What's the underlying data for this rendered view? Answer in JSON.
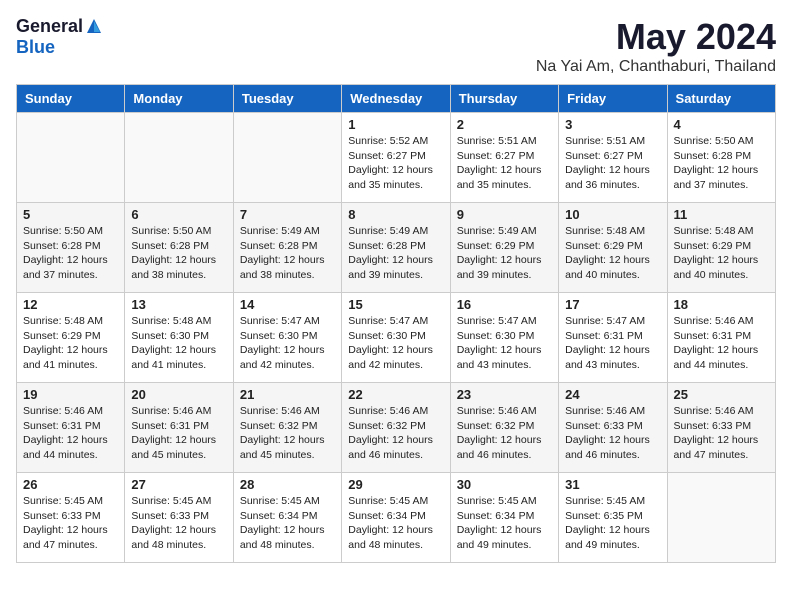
{
  "header": {
    "logo_general": "General",
    "logo_blue": "Blue",
    "month_title": "May 2024",
    "location": "Na Yai Am, Chanthaburi, Thailand"
  },
  "weekdays": [
    "Sunday",
    "Monday",
    "Tuesday",
    "Wednesday",
    "Thursday",
    "Friday",
    "Saturday"
  ],
  "weeks": [
    [
      {
        "day": "",
        "sunrise": "",
        "sunset": "",
        "daylight": "",
        "empty": true
      },
      {
        "day": "",
        "sunrise": "",
        "sunset": "",
        "daylight": "",
        "empty": true
      },
      {
        "day": "",
        "sunrise": "",
        "sunset": "",
        "daylight": "",
        "empty": true
      },
      {
        "day": "1",
        "sunrise": "Sunrise: 5:52 AM",
        "sunset": "Sunset: 6:27 PM",
        "daylight": "Daylight: 12 hours and 35 minutes.",
        "empty": false
      },
      {
        "day": "2",
        "sunrise": "Sunrise: 5:51 AM",
        "sunset": "Sunset: 6:27 PM",
        "daylight": "Daylight: 12 hours and 35 minutes.",
        "empty": false
      },
      {
        "day": "3",
        "sunrise": "Sunrise: 5:51 AM",
        "sunset": "Sunset: 6:27 PM",
        "daylight": "Daylight: 12 hours and 36 minutes.",
        "empty": false
      },
      {
        "day": "4",
        "sunrise": "Sunrise: 5:50 AM",
        "sunset": "Sunset: 6:28 PM",
        "daylight": "Daylight: 12 hours and 37 minutes.",
        "empty": false
      }
    ],
    [
      {
        "day": "5",
        "sunrise": "Sunrise: 5:50 AM",
        "sunset": "Sunset: 6:28 PM",
        "daylight": "Daylight: 12 hours and 37 minutes.",
        "empty": false
      },
      {
        "day": "6",
        "sunrise": "Sunrise: 5:50 AM",
        "sunset": "Sunset: 6:28 PM",
        "daylight": "Daylight: 12 hours and 38 minutes.",
        "empty": false
      },
      {
        "day": "7",
        "sunrise": "Sunrise: 5:49 AM",
        "sunset": "Sunset: 6:28 PM",
        "daylight": "Daylight: 12 hours and 38 minutes.",
        "empty": false
      },
      {
        "day": "8",
        "sunrise": "Sunrise: 5:49 AM",
        "sunset": "Sunset: 6:28 PM",
        "daylight": "Daylight: 12 hours and 39 minutes.",
        "empty": false
      },
      {
        "day": "9",
        "sunrise": "Sunrise: 5:49 AM",
        "sunset": "Sunset: 6:29 PM",
        "daylight": "Daylight: 12 hours and 39 minutes.",
        "empty": false
      },
      {
        "day": "10",
        "sunrise": "Sunrise: 5:48 AM",
        "sunset": "Sunset: 6:29 PM",
        "daylight": "Daylight: 12 hours and 40 minutes.",
        "empty": false
      },
      {
        "day": "11",
        "sunrise": "Sunrise: 5:48 AM",
        "sunset": "Sunset: 6:29 PM",
        "daylight": "Daylight: 12 hours and 40 minutes.",
        "empty": false
      }
    ],
    [
      {
        "day": "12",
        "sunrise": "Sunrise: 5:48 AM",
        "sunset": "Sunset: 6:29 PM",
        "daylight": "Daylight: 12 hours and 41 minutes.",
        "empty": false
      },
      {
        "day": "13",
        "sunrise": "Sunrise: 5:48 AM",
        "sunset": "Sunset: 6:30 PM",
        "daylight": "Daylight: 12 hours and 41 minutes.",
        "empty": false
      },
      {
        "day": "14",
        "sunrise": "Sunrise: 5:47 AM",
        "sunset": "Sunset: 6:30 PM",
        "daylight": "Daylight: 12 hours and 42 minutes.",
        "empty": false
      },
      {
        "day": "15",
        "sunrise": "Sunrise: 5:47 AM",
        "sunset": "Sunset: 6:30 PM",
        "daylight": "Daylight: 12 hours and 42 minutes.",
        "empty": false
      },
      {
        "day": "16",
        "sunrise": "Sunrise: 5:47 AM",
        "sunset": "Sunset: 6:30 PM",
        "daylight": "Daylight: 12 hours and 43 minutes.",
        "empty": false
      },
      {
        "day": "17",
        "sunrise": "Sunrise: 5:47 AM",
        "sunset": "Sunset: 6:31 PM",
        "daylight": "Daylight: 12 hours and 43 minutes.",
        "empty": false
      },
      {
        "day": "18",
        "sunrise": "Sunrise: 5:46 AM",
        "sunset": "Sunset: 6:31 PM",
        "daylight": "Daylight: 12 hours and 44 minutes.",
        "empty": false
      }
    ],
    [
      {
        "day": "19",
        "sunrise": "Sunrise: 5:46 AM",
        "sunset": "Sunset: 6:31 PM",
        "daylight": "Daylight: 12 hours and 44 minutes.",
        "empty": false
      },
      {
        "day": "20",
        "sunrise": "Sunrise: 5:46 AM",
        "sunset": "Sunset: 6:31 PM",
        "daylight": "Daylight: 12 hours and 45 minutes.",
        "empty": false
      },
      {
        "day": "21",
        "sunrise": "Sunrise: 5:46 AM",
        "sunset": "Sunset: 6:32 PM",
        "daylight": "Daylight: 12 hours and 45 minutes.",
        "empty": false
      },
      {
        "day": "22",
        "sunrise": "Sunrise: 5:46 AM",
        "sunset": "Sunset: 6:32 PM",
        "daylight": "Daylight: 12 hours and 46 minutes.",
        "empty": false
      },
      {
        "day": "23",
        "sunrise": "Sunrise: 5:46 AM",
        "sunset": "Sunset: 6:32 PM",
        "daylight": "Daylight: 12 hours and 46 minutes.",
        "empty": false
      },
      {
        "day": "24",
        "sunrise": "Sunrise: 5:46 AM",
        "sunset": "Sunset: 6:33 PM",
        "daylight": "Daylight: 12 hours and 46 minutes.",
        "empty": false
      },
      {
        "day": "25",
        "sunrise": "Sunrise: 5:46 AM",
        "sunset": "Sunset: 6:33 PM",
        "daylight": "Daylight: 12 hours and 47 minutes.",
        "empty": false
      }
    ],
    [
      {
        "day": "26",
        "sunrise": "Sunrise: 5:45 AM",
        "sunset": "Sunset: 6:33 PM",
        "daylight": "Daylight: 12 hours and 47 minutes.",
        "empty": false
      },
      {
        "day": "27",
        "sunrise": "Sunrise: 5:45 AM",
        "sunset": "Sunset: 6:33 PM",
        "daylight": "Daylight: 12 hours and 48 minutes.",
        "empty": false
      },
      {
        "day": "28",
        "sunrise": "Sunrise: 5:45 AM",
        "sunset": "Sunset: 6:34 PM",
        "daylight": "Daylight: 12 hours and 48 minutes.",
        "empty": false
      },
      {
        "day": "29",
        "sunrise": "Sunrise: 5:45 AM",
        "sunset": "Sunset: 6:34 PM",
        "daylight": "Daylight: 12 hours and 48 minutes.",
        "empty": false
      },
      {
        "day": "30",
        "sunrise": "Sunrise: 5:45 AM",
        "sunset": "Sunset: 6:34 PM",
        "daylight": "Daylight: 12 hours and 49 minutes.",
        "empty": false
      },
      {
        "day": "31",
        "sunrise": "Sunrise: 5:45 AM",
        "sunset": "Sunset: 6:35 PM",
        "daylight": "Daylight: 12 hours and 49 minutes.",
        "empty": false
      },
      {
        "day": "",
        "sunrise": "",
        "sunset": "",
        "daylight": "",
        "empty": true
      }
    ]
  ]
}
